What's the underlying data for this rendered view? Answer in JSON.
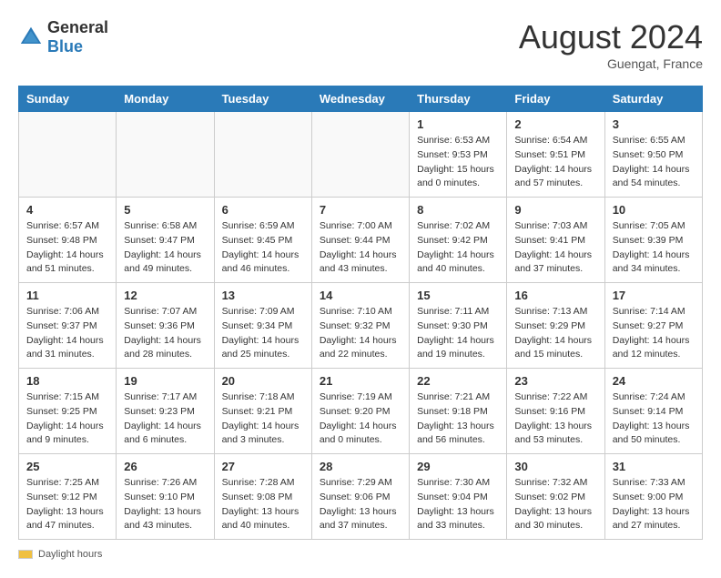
{
  "header": {
    "logo": {
      "general": "General",
      "blue": "Blue"
    },
    "title": "August 2024",
    "location": "Guengat, France"
  },
  "weekdays": [
    "Sunday",
    "Monday",
    "Tuesday",
    "Wednesday",
    "Thursday",
    "Friday",
    "Saturday"
  ],
  "weeks": [
    [
      {
        "day": "",
        "info": ""
      },
      {
        "day": "",
        "info": ""
      },
      {
        "day": "",
        "info": ""
      },
      {
        "day": "",
        "info": ""
      },
      {
        "day": "1",
        "info": "Sunrise: 6:53 AM\nSunset: 9:53 PM\nDaylight: 15 hours and 0 minutes."
      },
      {
        "day": "2",
        "info": "Sunrise: 6:54 AM\nSunset: 9:51 PM\nDaylight: 14 hours and 57 minutes."
      },
      {
        "day": "3",
        "info": "Sunrise: 6:55 AM\nSunset: 9:50 PM\nDaylight: 14 hours and 54 minutes."
      }
    ],
    [
      {
        "day": "4",
        "info": "Sunrise: 6:57 AM\nSunset: 9:48 PM\nDaylight: 14 hours and 51 minutes."
      },
      {
        "day": "5",
        "info": "Sunrise: 6:58 AM\nSunset: 9:47 PM\nDaylight: 14 hours and 49 minutes."
      },
      {
        "day": "6",
        "info": "Sunrise: 6:59 AM\nSunset: 9:45 PM\nDaylight: 14 hours and 46 minutes."
      },
      {
        "day": "7",
        "info": "Sunrise: 7:00 AM\nSunset: 9:44 PM\nDaylight: 14 hours and 43 minutes."
      },
      {
        "day": "8",
        "info": "Sunrise: 7:02 AM\nSunset: 9:42 PM\nDaylight: 14 hours and 40 minutes."
      },
      {
        "day": "9",
        "info": "Sunrise: 7:03 AM\nSunset: 9:41 PM\nDaylight: 14 hours and 37 minutes."
      },
      {
        "day": "10",
        "info": "Sunrise: 7:05 AM\nSunset: 9:39 PM\nDaylight: 14 hours and 34 minutes."
      }
    ],
    [
      {
        "day": "11",
        "info": "Sunrise: 7:06 AM\nSunset: 9:37 PM\nDaylight: 14 hours and 31 minutes."
      },
      {
        "day": "12",
        "info": "Sunrise: 7:07 AM\nSunset: 9:36 PM\nDaylight: 14 hours and 28 minutes."
      },
      {
        "day": "13",
        "info": "Sunrise: 7:09 AM\nSunset: 9:34 PM\nDaylight: 14 hours and 25 minutes."
      },
      {
        "day": "14",
        "info": "Sunrise: 7:10 AM\nSunset: 9:32 PM\nDaylight: 14 hours and 22 minutes."
      },
      {
        "day": "15",
        "info": "Sunrise: 7:11 AM\nSunset: 9:30 PM\nDaylight: 14 hours and 19 minutes."
      },
      {
        "day": "16",
        "info": "Sunrise: 7:13 AM\nSunset: 9:29 PM\nDaylight: 14 hours and 15 minutes."
      },
      {
        "day": "17",
        "info": "Sunrise: 7:14 AM\nSunset: 9:27 PM\nDaylight: 14 hours and 12 minutes."
      }
    ],
    [
      {
        "day": "18",
        "info": "Sunrise: 7:15 AM\nSunset: 9:25 PM\nDaylight: 14 hours and 9 minutes."
      },
      {
        "day": "19",
        "info": "Sunrise: 7:17 AM\nSunset: 9:23 PM\nDaylight: 14 hours and 6 minutes."
      },
      {
        "day": "20",
        "info": "Sunrise: 7:18 AM\nSunset: 9:21 PM\nDaylight: 14 hours and 3 minutes."
      },
      {
        "day": "21",
        "info": "Sunrise: 7:19 AM\nSunset: 9:20 PM\nDaylight: 14 hours and 0 minutes."
      },
      {
        "day": "22",
        "info": "Sunrise: 7:21 AM\nSunset: 9:18 PM\nDaylight: 13 hours and 56 minutes."
      },
      {
        "day": "23",
        "info": "Sunrise: 7:22 AM\nSunset: 9:16 PM\nDaylight: 13 hours and 53 minutes."
      },
      {
        "day": "24",
        "info": "Sunrise: 7:24 AM\nSunset: 9:14 PM\nDaylight: 13 hours and 50 minutes."
      }
    ],
    [
      {
        "day": "25",
        "info": "Sunrise: 7:25 AM\nSunset: 9:12 PM\nDaylight: 13 hours and 47 minutes."
      },
      {
        "day": "26",
        "info": "Sunrise: 7:26 AM\nSunset: 9:10 PM\nDaylight: 13 hours and 43 minutes."
      },
      {
        "day": "27",
        "info": "Sunrise: 7:28 AM\nSunset: 9:08 PM\nDaylight: 13 hours and 40 minutes."
      },
      {
        "day": "28",
        "info": "Sunrise: 7:29 AM\nSunset: 9:06 PM\nDaylight: 13 hours and 37 minutes."
      },
      {
        "day": "29",
        "info": "Sunrise: 7:30 AM\nSunset: 9:04 PM\nDaylight: 13 hours and 33 minutes."
      },
      {
        "day": "30",
        "info": "Sunrise: 7:32 AM\nSunset: 9:02 PM\nDaylight: 13 hours and 30 minutes."
      },
      {
        "day": "31",
        "info": "Sunrise: 7:33 AM\nSunset: 9:00 PM\nDaylight: 13 hours and 27 minutes."
      }
    ]
  ],
  "footer": {
    "daylight_label": "Daylight hours"
  }
}
